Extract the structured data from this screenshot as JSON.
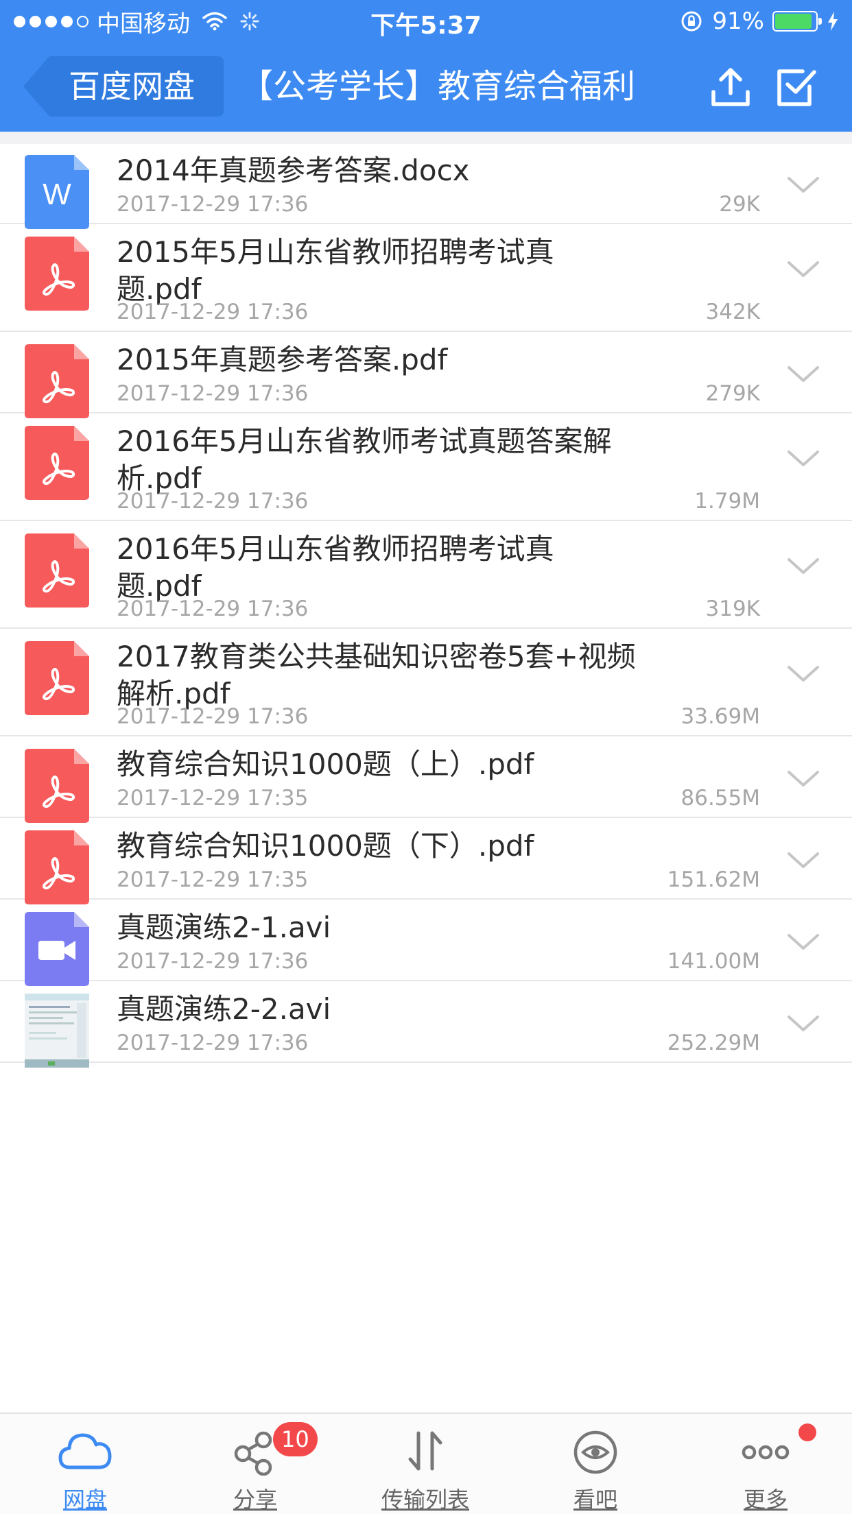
{
  "status_bar": {
    "carrier": "中国移动",
    "time": "下午5:37",
    "battery_percent": "91%",
    "battery_level": 0.91,
    "signal_bars_filled": 4
  },
  "nav": {
    "back_label": "百度网盘",
    "title": "【公考学长】教育综合福利",
    "upload_icon": "upload-icon",
    "select_icon": "checkbox-select-icon"
  },
  "files": [
    {
      "name": "2014年真题参考答案.docx",
      "date": "2017-12-29 17:36",
      "size": "29K",
      "type": "word",
      "icon_letter": "W"
    },
    {
      "name": "2015年5月山东省教师招聘考试真",
      "name_line2": "题.pdf",
      "date": "2017-12-29 17:36",
      "size": "342K",
      "type": "pdf"
    },
    {
      "name": "2015年真题参考答案.pdf",
      "date": "2017-12-29 17:36",
      "size": "279K",
      "type": "pdf"
    },
    {
      "name": "2016年5月山东省教师考试真题答案解",
      "name_line2": "析.pdf",
      "date": "2017-12-29 17:36",
      "size": "1.79M",
      "type": "pdf"
    },
    {
      "name": "2016年5月山东省教师招聘考试真",
      "name_line2": "题.pdf",
      "date": "2017-12-29 17:36",
      "size": "319K",
      "type": "pdf"
    },
    {
      "name": "2017教育类公共基础知识密卷5套+视频",
      "name_line2": "解析.pdf",
      "date": "2017-12-29 17:36",
      "size": "33.69M",
      "type": "pdf"
    },
    {
      "name": "教育综合知识1000题（上）.pdf",
      "date": "2017-12-29 17:35",
      "size": "86.55M",
      "type": "pdf"
    },
    {
      "name": "教育综合知识1000题（下）.pdf",
      "date": "2017-12-29 17:35",
      "size": "151.62M",
      "type": "pdf"
    },
    {
      "name": "真题演练2-1.avi",
      "date": "2017-12-29 17:36",
      "size": "141.00M",
      "type": "video"
    },
    {
      "name": "真题演练2-2.avi",
      "date": "2017-12-29 17:36",
      "size": "252.29M",
      "type": "video-thumb"
    }
  ],
  "tabs": [
    {
      "label": "网盘",
      "icon": "cloud-icon",
      "active": true
    },
    {
      "label": "分享",
      "icon": "share-icon",
      "badge": "10"
    },
    {
      "label": "传输列表",
      "icon": "transfer-icon"
    },
    {
      "label": "看吧",
      "icon": "eye-icon"
    },
    {
      "label": "更多",
      "icon": "more-icon",
      "dot": true
    }
  ],
  "colors": {
    "accent": "#3d8bf2",
    "pdf": "#f65a5a",
    "word": "#4a90f5",
    "video": "#7c7cf2",
    "badge": "#f2484a",
    "battery": "#4cd964"
  }
}
